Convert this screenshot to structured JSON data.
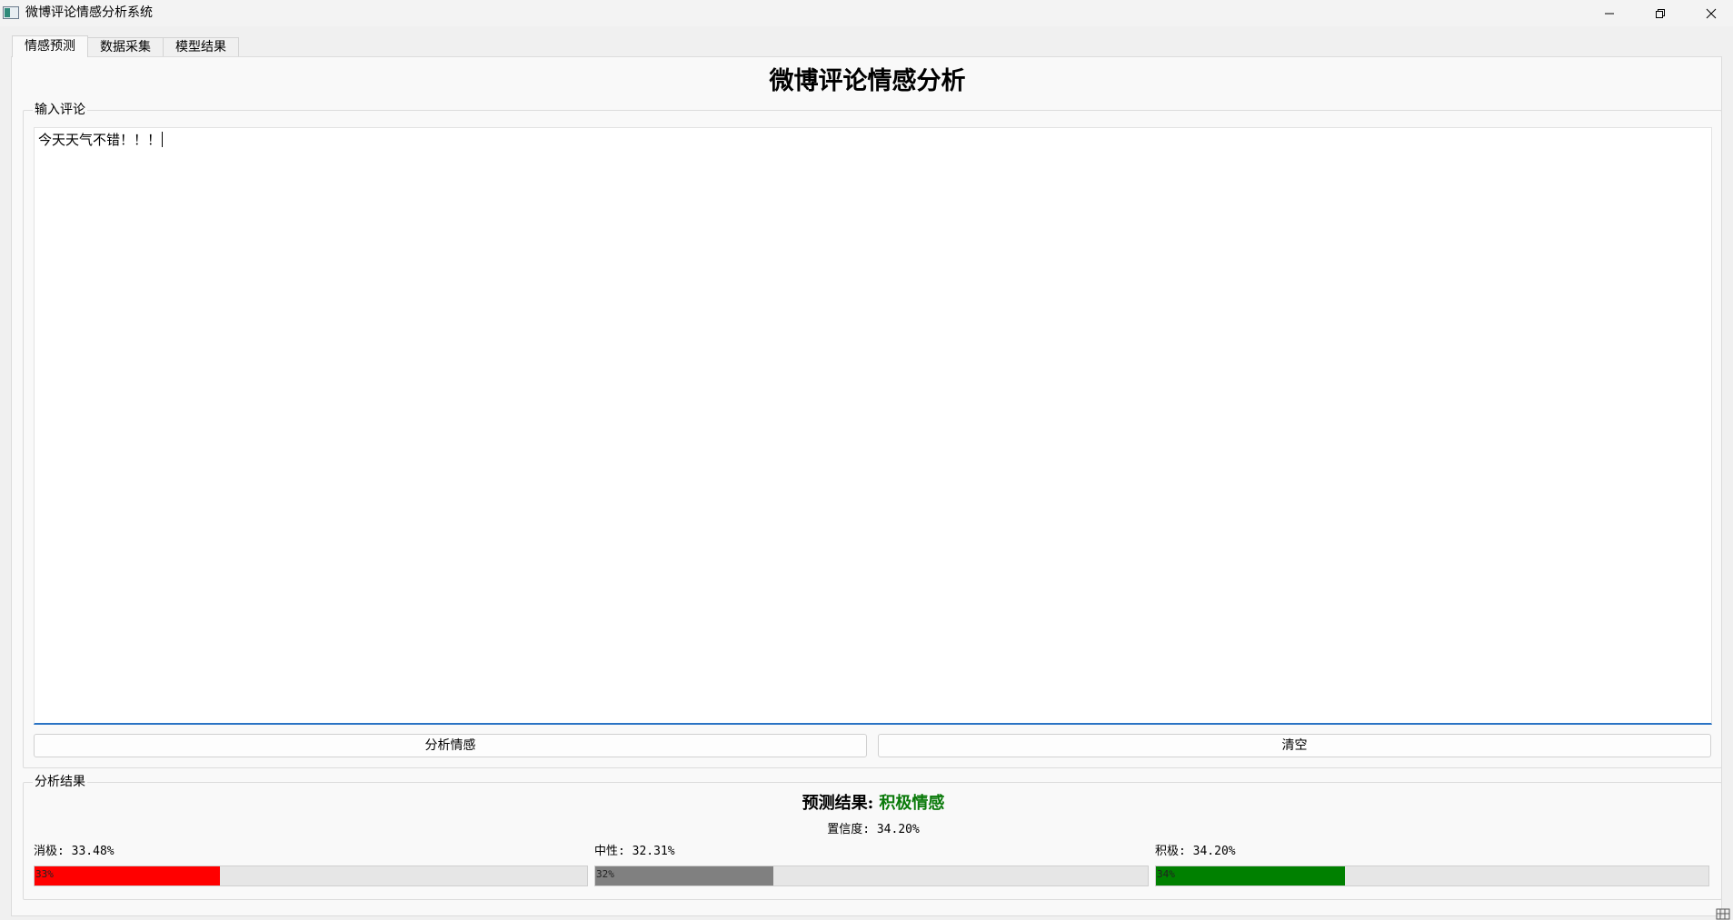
{
  "window": {
    "title": "微博评论情感分析系统"
  },
  "tabs": [
    {
      "label": "情感预测",
      "active": true
    },
    {
      "label": "数据采集",
      "active": false
    },
    {
      "label": "模型结果",
      "active": false
    }
  ],
  "page": {
    "title": "微博评论情感分析"
  },
  "input_group": {
    "title": "输入评论",
    "text": "今天天气不错！！！",
    "analyze_button": "分析情感",
    "clear_button": "清空"
  },
  "result_group": {
    "title": "分析结果",
    "prediction_label": "预测结果:",
    "prediction_value": "积极情感",
    "confidence_text": "置信度: 34.20%",
    "probabilities": [
      {
        "label": "消极: 33.48%",
        "bar_text": "33%",
        "percent": 33.48,
        "color": "#ff0000"
      },
      {
        "label": "中性: 32.31%",
        "bar_text": "32%",
        "percent": 32.31,
        "color": "#808080"
      },
      {
        "label": "积极: 34.20%",
        "bar_text": "34%",
        "percent": 34.2,
        "color": "#008000"
      }
    ]
  },
  "colors": {
    "positive": "#0a7a0a",
    "focus_border": "#2a73c4"
  }
}
